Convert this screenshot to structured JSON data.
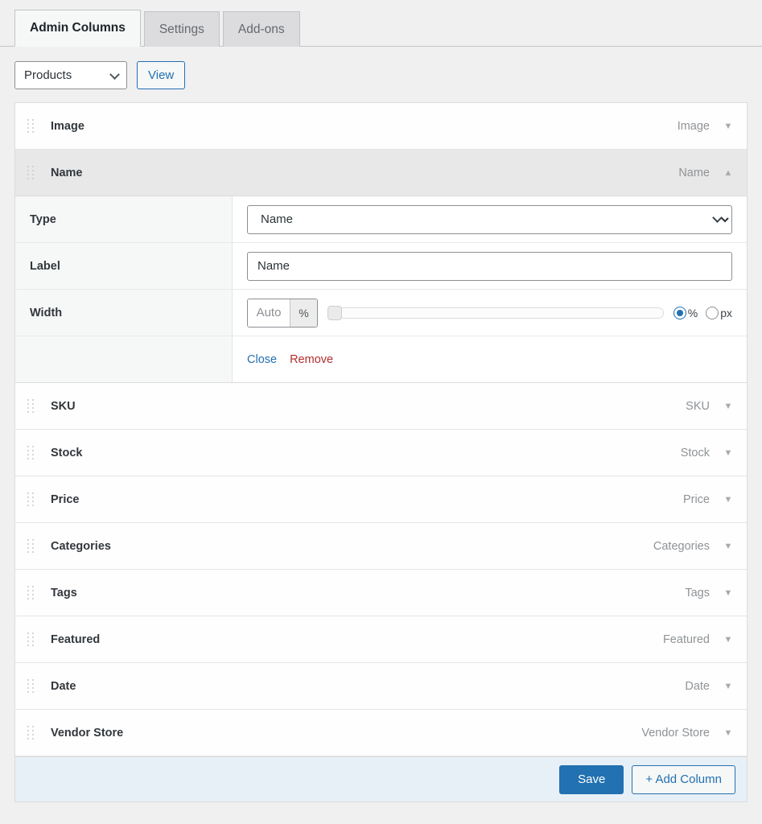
{
  "tabs": [
    {
      "label": "Admin Columns",
      "active": true
    },
    {
      "label": "Settings",
      "active": false
    },
    {
      "label": "Add-ons",
      "active": false
    }
  ],
  "toolbar": {
    "list_select_value": "Products",
    "view_button": "View"
  },
  "columns": [
    {
      "label": "Image",
      "type": "Image",
      "expanded": false,
      "toggle": "▼"
    },
    {
      "label": "Name",
      "type": "Name",
      "expanded": true,
      "toggle": "▲"
    },
    {
      "label": "SKU",
      "type": "SKU",
      "expanded": false,
      "toggle": "▼"
    },
    {
      "label": "Stock",
      "type": "Stock",
      "expanded": false,
      "toggle": "▼"
    },
    {
      "label": "Price",
      "type": "Price",
      "expanded": false,
      "toggle": "▼"
    },
    {
      "label": "Categories",
      "type": "Categories",
      "expanded": false,
      "toggle": "▼"
    },
    {
      "label": "Tags",
      "type": "Tags",
      "expanded": false,
      "toggle": "▼"
    },
    {
      "label": "Featured",
      "type": "Featured",
      "expanded": false,
      "toggle": "▼"
    },
    {
      "label": "Date",
      "type": "Date",
      "expanded": false,
      "toggle": "▼"
    },
    {
      "label": "Vendor Store",
      "type": "Vendor Store",
      "expanded": false,
      "toggle": "▼"
    }
  ],
  "settings_panel": {
    "type_row_label": "Type",
    "type_value": "Name",
    "label_row_label": "Label",
    "label_value": "Name",
    "width_row_label": "Width",
    "width_placeholder": "Auto",
    "width_value": "",
    "width_unit_suffix": "%",
    "slider_value": 0,
    "unit_percent": "%",
    "unit_px": "px",
    "unit_selected": "%",
    "close_link": "Close",
    "remove_link": "Remove"
  },
  "footer": {
    "save_label": "Save",
    "add_column_label": "+ Add Column"
  },
  "colors": {
    "accent_blue": "#2271b1",
    "danger_red": "#b32d2e",
    "page_bg": "#f0f0f1",
    "footer_bg": "#e8f0f7",
    "expanded_row_bg": "#e8e8e8"
  }
}
